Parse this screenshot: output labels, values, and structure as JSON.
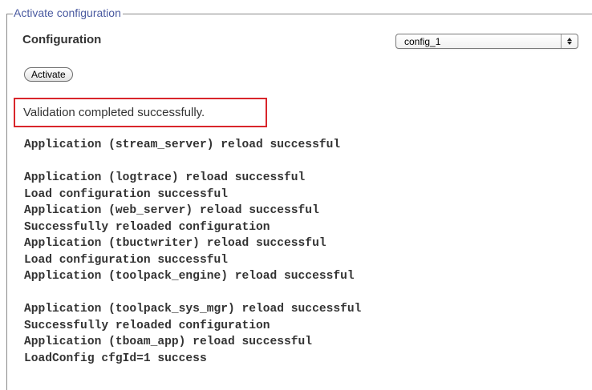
{
  "panel": {
    "legend": "Activate configuration"
  },
  "configuration": {
    "label": "Configuration",
    "select_value": "config_1",
    "arrows_icon": "updown-arrows-icon"
  },
  "activate_button": {
    "label": "Activate"
  },
  "validation": {
    "message": "Validation completed successfully.",
    "highlight_color": "#d9262b"
  },
  "log": {
    "lines": [
      "Application (stream_server) reload successful",
      "",
      "Application (logtrace) reload successful",
      "Load configuration successful",
      "Application (web_server) reload successful",
      "Successfully reloaded configuration",
      "Application (tbuctwriter) reload successful",
      "Load configuration successful",
      "Application (toolpack_engine) reload successful",
      "",
      "Application (toolpack_sys_mgr) reload successful",
      "Successfully reloaded configuration",
      "Application (tboam_app) reload successful",
      "LoadConfig cfgId=1 success"
    ]
  }
}
